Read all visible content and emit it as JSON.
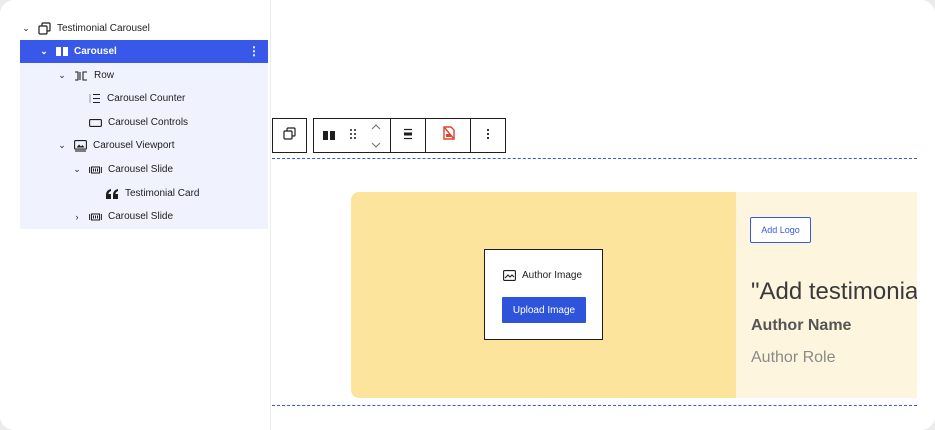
{
  "list_view": {
    "items": [
      {
        "label": "Testimonial Carousel",
        "icon": "duplicate-icon",
        "chevron": "expanded"
      },
      {
        "label": "Carousel",
        "icon": "columns-icon",
        "chevron": "expanded",
        "selected": true
      },
      {
        "label": "Row",
        "icon": "row-icon",
        "chevron": "expanded"
      },
      {
        "label": "Carousel Counter",
        "icon": "list-counter-icon",
        "chevron": "none"
      },
      {
        "label": "Carousel Controls",
        "icon": "rectangle-icon",
        "chevron": "none"
      },
      {
        "label": "Carousel Viewport",
        "icon": "viewport-icon",
        "chevron": "expanded"
      },
      {
        "label": "Carousel Slide",
        "icon": "slide-icon",
        "chevron": "expanded"
      },
      {
        "label": "Testimonial Card",
        "icon": "quote-icon",
        "chevron": "none"
      },
      {
        "label": "Carousel Slide",
        "icon": "slide-icon",
        "chevron": "collapsed"
      }
    ]
  },
  "toolbar": {
    "buttons": [
      "parent-block-icon",
      "columns-icon",
      "drag-handle-icon",
      "move-up-icon",
      "move-down-icon",
      "align-icon",
      "style-icon",
      "options-icon"
    ]
  },
  "slide": {
    "image_placeholder": {
      "label": "Author Image",
      "button": "Upload Image"
    },
    "add_logo": "Add Logo",
    "quote": "\"Add testimonia",
    "author_name": "Author Name",
    "author_role": "Author Role"
  },
  "colors": {
    "accent": "#3858e9",
    "upload_button": "#2f54dc",
    "slide_left": "#fce49d",
    "slide_right": "#fdf5de",
    "style_icon": "#e2432e"
  }
}
